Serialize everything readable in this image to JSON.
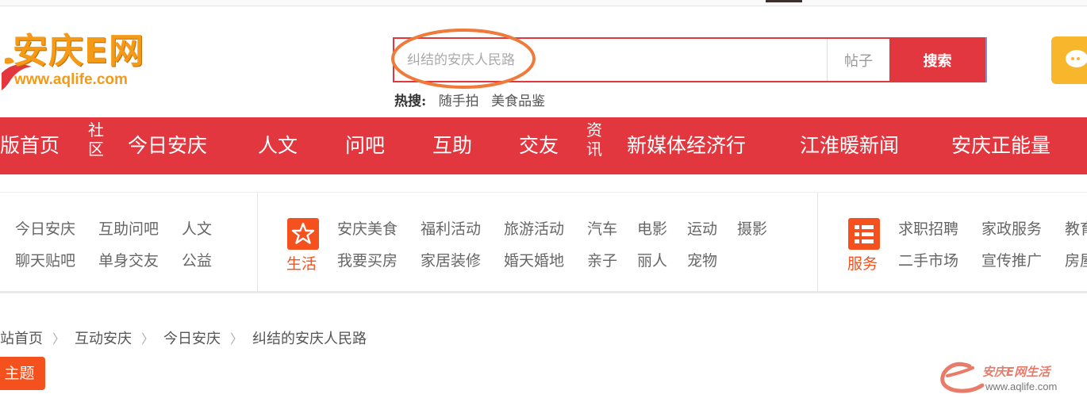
{
  "logo": {
    "title": "安庆E网",
    "url": "www.aqlife.com"
  },
  "search": {
    "placeholder": "纠结的安庆人民路",
    "type": "帖子",
    "button": "搜索",
    "hot_label": "热搜:",
    "hot_keywords": [
      "随手拍",
      "美食品鉴"
    ]
  },
  "nav": {
    "items": [
      "版首页",
      "今日安庆",
      "人文",
      "问吧",
      "互助",
      "交友",
      "新媒体经济行",
      "江淮暖新闻",
      "安庆正能量"
    ],
    "tags": [
      "社区",
      "资讯"
    ]
  },
  "categories": {
    "community": [
      "今日安庆",
      "互助问吧",
      "人文",
      "聊天贴吧",
      "单身交友",
      "公益"
    ],
    "life_label": "生活",
    "life": [
      "安庆美食",
      "福利活动",
      "旅游活动",
      "汽车",
      "电影",
      "运动",
      "摄影",
      "我要买房",
      "家居装修",
      "婚天婚地",
      "亲子",
      "丽人",
      "宠物"
    ],
    "service_label": "服务",
    "service": [
      "求职招聘",
      "家政服务",
      "教育",
      "二手市场",
      "宣传推广",
      "房屋"
    ]
  },
  "breadcrumb": [
    "站首页",
    "互动安庆",
    "今日安庆",
    "纠结的安庆人民路"
  ],
  "topic_button": "主题",
  "watermark": {
    "text": "安庆E网生活",
    "url": "www.aqlife.com"
  },
  "colors": {
    "brand_red": "#e2373f",
    "orange": "#f4511e",
    "logo_orange": "#f39a17",
    "annotation": "#f07a3a"
  }
}
